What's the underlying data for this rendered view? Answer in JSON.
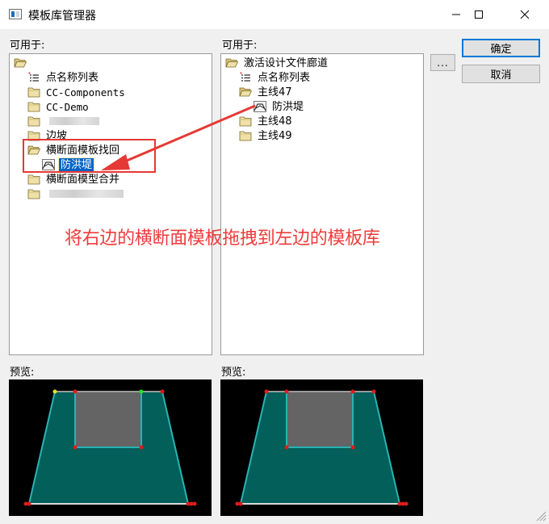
{
  "window": {
    "title": "模板库管理器",
    "icons": {
      "app": "window-app-icon",
      "minimize": "minimize-icon",
      "maximize": "maximize-icon",
      "close": "close-icon"
    }
  },
  "left_panel": {
    "label": "可用于:",
    "preview_label": "预览:",
    "items": [
      {
        "label": "",
        "icon": "folder-open-icon"
      },
      {
        "label": "点名称列表",
        "icon": "list-icon"
      },
      {
        "label": "CC-Components",
        "icon": "folder-icon"
      },
      {
        "label": "CC-Demo",
        "icon": "folder-icon"
      },
      {
        "label": "",
        "icon": "folder-icon"
      },
      {
        "label": "边坡",
        "icon": "folder-icon"
      },
      {
        "label": "横断面模板找回",
        "icon": "folder-open-icon"
      },
      {
        "label": "防洪堤",
        "icon": "template-icon"
      },
      {
        "label": "横断面模型合并",
        "icon": "folder-icon"
      },
      {
        "label": "",
        "icon": "folder-icon"
      }
    ]
  },
  "right_panel": {
    "label": "可用于:",
    "preview_label": "预览:",
    "items": [
      {
        "label": "激活设计文件廊道",
        "icon": "folder-open-icon"
      },
      {
        "label": "点名称列表",
        "icon": "list-icon"
      },
      {
        "label": "主线47",
        "icon": "folder-open-icon"
      },
      {
        "label": "防洪堤",
        "icon": "template-icon"
      },
      {
        "label": "主线48",
        "icon": "folder-icon"
      },
      {
        "label": "主线49",
        "icon": "folder-icon"
      }
    ]
  },
  "buttons": {
    "browse": "...",
    "ok": "确定",
    "cancel": "取消"
  },
  "annotation": {
    "text": "将右边的横断面模板拖拽到左边的模板库"
  },
  "colors": {
    "selection": "#0a64c8",
    "annotation": "#ef3b3b",
    "preview_fill": "#025f5a",
    "preview_edge": "#2ab3b3",
    "preview_inner": "#646464",
    "preview_point": "#e01b1b"
  }
}
